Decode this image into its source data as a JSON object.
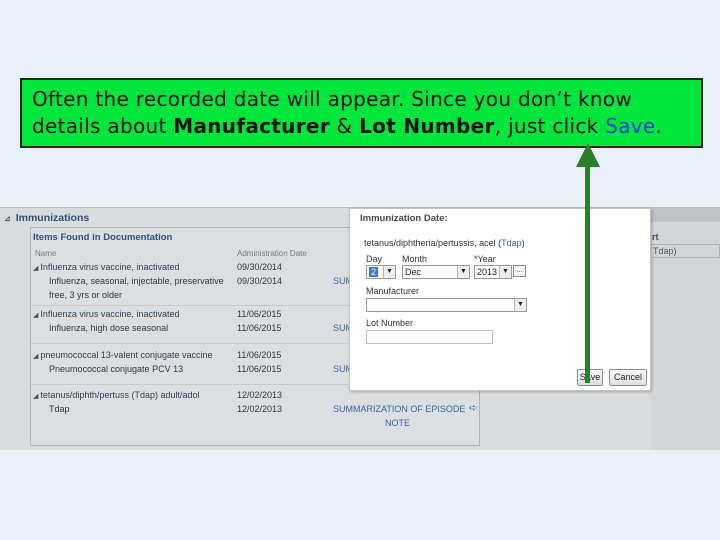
{
  "callout": {
    "line1": "Often the recorded date will appear.  Since you don’t know",
    "line2_pre": "details about ",
    "manufacturer": "Manufacturer",
    "amp": " & ",
    "lot": "Lot Number",
    "line2_mid": ", just click ",
    "save": "Save",
    "period": "."
  },
  "section": {
    "title": "Immunizations",
    "toggle": "⊿"
  },
  "panel": {
    "title": "Items Found in Documentation",
    "col_name": "Name",
    "col_date": "Administration Date",
    "rows": [
      {
        "group": "Influenza virus vaccine, inactivated",
        "group_date": "09/30/2014",
        "detail": "Influenza, seasonal, injectable, preservative",
        "detail_date": "09/30/2014",
        "detail2": "free, 3 yrs or older",
        "link": "SUM"
      },
      {
        "group": "Influenza virus vaccine, inactivated",
        "group_date": "11/06/2015",
        "detail": "Influenza, high dose seasonal",
        "detail_date": "11/06/2015",
        "link": "SUM"
      },
      {
        "group": "pneumococcal 13-valent conjugate vaccine",
        "group_date": "11/06/2015",
        "detail": "Pneumococcal conjugate PCV 13",
        "detail_date": "11/06/2015",
        "link": "SUM"
      },
      {
        "group": "tetanus/diphth/pertuss (Tdap) adult/adol",
        "group_date": "12/02/2013",
        "detail": "Tdap",
        "detail_date": "12/02/2013",
        "link": "SUMMARIZATION OF EPISODE",
        "link2": "NOTE"
      }
    ]
  },
  "right_strip": {
    "label": "rt",
    "value": "Tdap)"
  },
  "dialog": {
    "title": "Immunization Date:",
    "vaccine_pre": "tetanus/diphtheria/pertussis, acel (",
    "vaccine_tdap": "Tdap",
    "vaccine_post": ")",
    "day_label": "Day",
    "month_label": "Month",
    "year_label": "*Year",
    "day_value": "2",
    "month_value": "Dec",
    "year_value": "2013",
    "manufacturer_label": "Manufacturer",
    "manufacturer_value": "",
    "lot_label": "Lot Number",
    "lot_value": "",
    "save_label": "Save",
    "cancel_label": "Cancel",
    "dropdown_glyph": "▼",
    "calendar_glyph": "..."
  }
}
